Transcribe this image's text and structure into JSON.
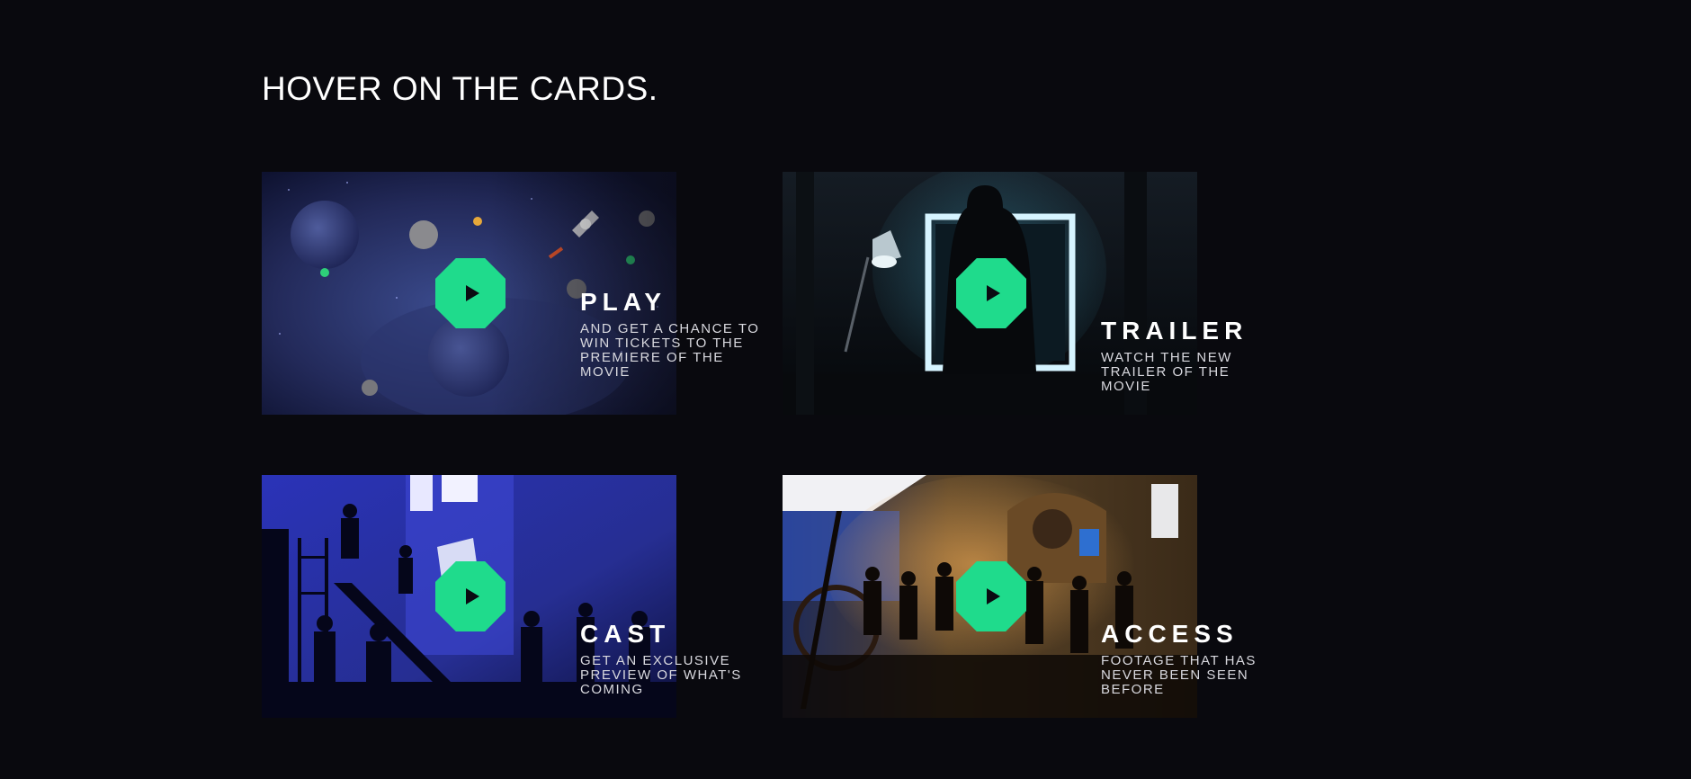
{
  "heading": "HOVER ON THE CARDS.",
  "accent_color": "#1fdb8c",
  "play_icon": "play-icon",
  "cards": [
    {
      "title": "PLAY",
      "desc_line1": "AND GET A CHANCE TO",
      "desc_line2": "WIN TICKETS TO THE PREMIERE OF THE MOVIE"
    },
    {
      "title": "TRAILER",
      "desc_line1": "WATCH THE NEW TRAILER OF THE MOVIE",
      "desc_line2": ""
    },
    {
      "title": "CAST",
      "desc_line1": "GET AN EXCLUSIVE PREVIEW OF WHAT'S COMING",
      "desc_line2": ""
    },
    {
      "title": "ACCESS",
      "desc_line1": "FOOTAGE THAT HAS NEVER BEEN SEEN BEFORE",
      "desc_line2": ""
    }
  ]
}
